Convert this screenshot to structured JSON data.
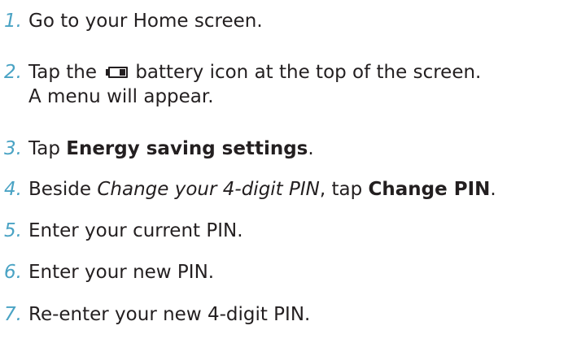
{
  "steps": [
    {
      "number": "1.",
      "text": "Go to your Home screen."
    },
    {
      "number": "2.",
      "text_before": "Tap the",
      "icon": "battery-icon",
      "text_after": "battery icon at the top of the screen.",
      "line2": "A menu will appear."
    },
    {
      "number": "3.",
      "text_before": "Tap",
      "bold": "Energy saving settings",
      "text_after": "."
    },
    {
      "number": "4.",
      "text_before": "Beside",
      "italic": "Change your 4-digit PIN",
      "text_middle": ", tap",
      "bold": "Change PIN",
      "text_after": "."
    },
    {
      "number": "5.",
      "text": "Enter your current PIN."
    },
    {
      "number": "6.",
      "text": "Enter your new PIN."
    },
    {
      "number": "7.",
      "text": "Re-enter your new 4-digit PIN."
    }
  ],
  "colors": {
    "number": "#4aa3c4",
    "text": "#231f20"
  }
}
